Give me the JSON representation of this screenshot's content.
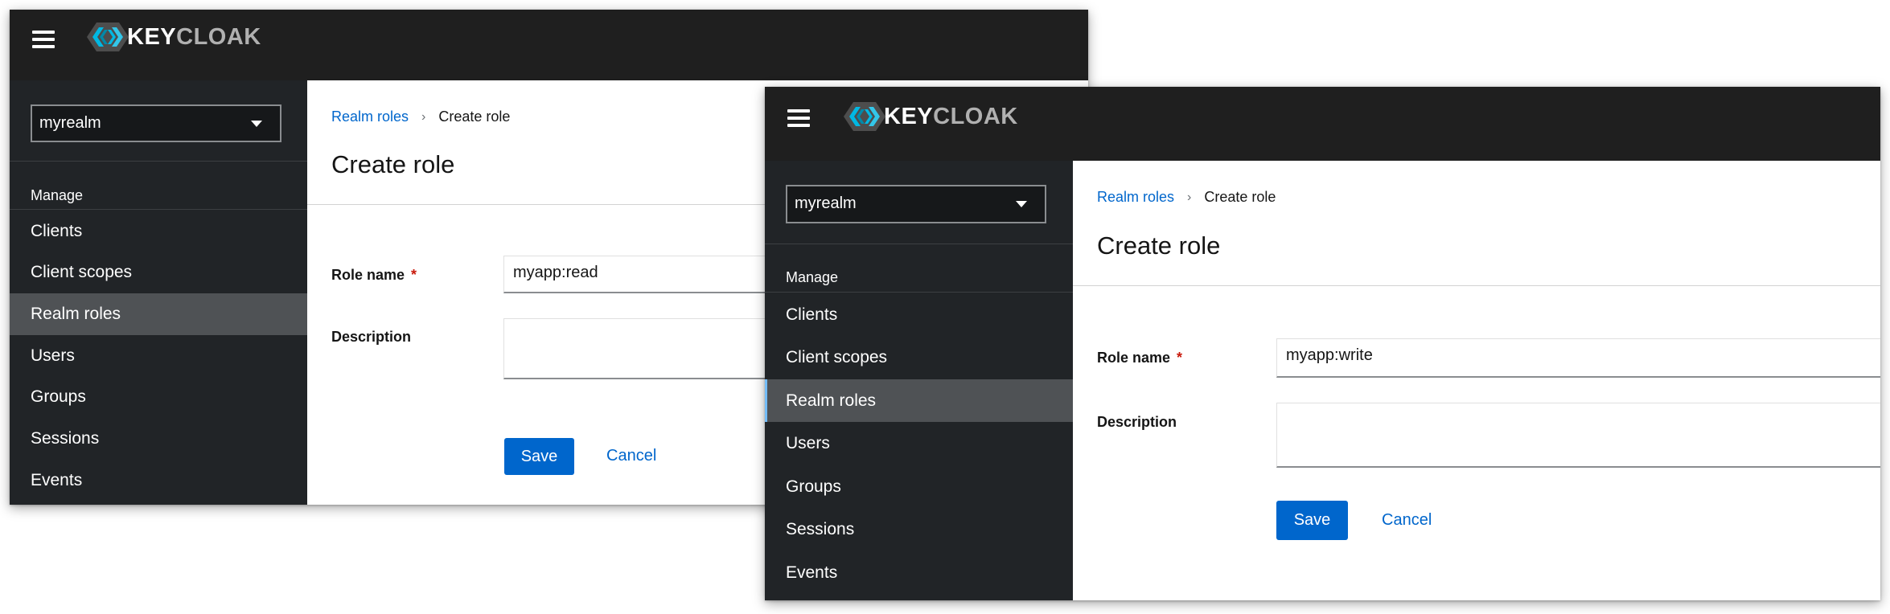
{
  "brand": {
    "logo_text_a": "KEY",
    "logo_text_b": "CLOAK"
  },
  "window_back": {
    "realm": "myrealm",
    "nav_section": "Manage",
    "nav_items": [
      "Clients",
      "Client scopes",
      "Realm roles",
      "Users",
      "Groups",
      "Sessions",
      "Events"
    ],
    "active_item": "Realm roles",
    "breadcrumb": {
      "parent": "Realm roles",
      "current": "Create role"
    },
    "title": "Create role",
    "role_name_label": "Role name",
    "required_mark": "*",
    "role_name_value": "myapp:read",
    "description_label": "Description",
    "description_value": "",
    "save_label": "Save",
    "cancel_label": "Cancel"
  },
  "window_front": {
    "realm": "myrealm",
    "nav_section": "Manage",
    "nav_items": [
      "Clients",
      "Client scopes",
      "Realm roles",
      "Users",
      "Groups",
      "Sessions",
      "Events"
    ],
    "active_item": "Realm roles",
    "breadcrumb": {
      "parent": "Realm roles",
      "current": "Create role"
    },
    "title": "Create role",
    "role_name_label": "Role name",
    "required_mark": "*",
    "role_name_value": "myapp:write",
    "description_label": "Description",
    "description_value": "",
    "save_label": "Save",
    "cancel_label": "Cancel"
  },
  "colors": {
    "masthead": "#1f1f1f",
    "sidebar": "#212427",
    "active_nav": "#4f5255",
    "primary": "#0066cc",
    "required": "#c9190b"
  },
  "icons": [
    "hamburger-menu-icon",
    "keycloak-logo-icon",
    "caret-down-icon",
    "chevron-right-icon"
  ]
}
